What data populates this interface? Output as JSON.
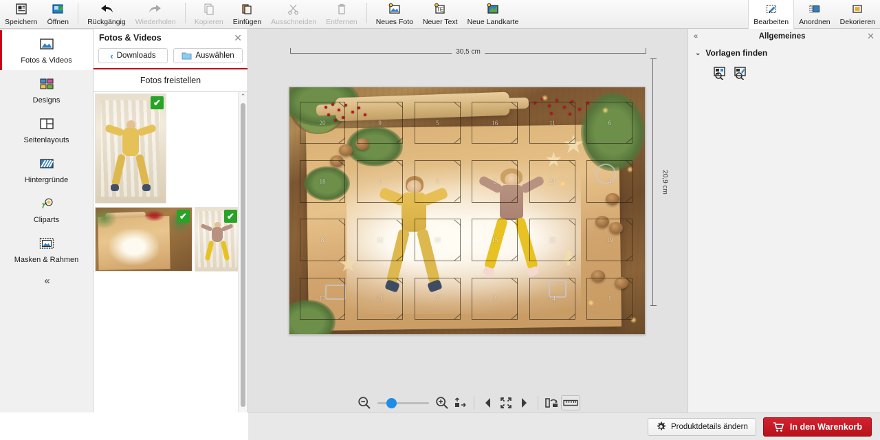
{
  "toolbar": {
    "groups": [
      {
        "items": [
          {
            "label": "Speichern",
            "icon": "save-icon",
            "enabled": true
          },
          {
            "label": "Öffnen",
            "icon": "open-folder-icon",
            "enabled": true
          }
        ]
      },
      {
        "items": [
          {
            "label": "Rückgängig",
            "icon": "undo-arrow-icon",
            "enabled": true
          },
          {
            "label": "Wiederholen",
            "icon": "redo-arrow-icon",
            "enabled": false
          }
        ]
      },
      {
        "items": [
          {
            "label": "Kopieren",
            "icon": "copy-icon",
            "enabled": false
          },
          {
            "label": "Einfügen",
            "icon": "paste-icon",
            "enabled": true
          },
          {
            "label": "Ausschneiden",
            "icon": "scissors-icon",
            "enabled": false
          },
          {
            "label": "Entfernen",
            "icon": "trash-icon",
            "enabled": false
          }
        ]
      },
      {
        "items": [
          {
            "label": "Neues Foto",
            "icon": "new-photo-icon",
            "enabled": true
          },
          {
            "label": "Neuer Text",
            "icon": "new-text-icon",
            "enabled": true
          },
          {
            "label": "Neue Landkarte",
            "icon": "new-map-icon",
            "enabled": true
          }
        ]
      }
    ],
    "right_items": [
      {
        "label": "Bearbeiten",
        "icon": "edit-pencil-icon",
        "active": true
      },
      {
        "label": "Anordnen",
        "icon": "arrange-icon",
        "active": false
      },
      {
        "label": "Dekorieren",
        "icon": "decorate-frame-icon",
        "active": false
      }
    ]
  },
  "sidebar": {
    "items": [
      {
        "label": "Fotos & Videos",
        "icon": "photo-icon",
        "selected": true
      },
      {
        "label": "Designs",
        "icon": "designs-grid-icon",
        "selected": false
      },
      {
        "label": "Seitenlayouts",
        "icon": "page-layout-icon",
        "selected": false
      },
      {
        "label": "Hintergründe",
        "icon": "background-pattern-icon",
        "selected": false
      },
      {
        "label": "Cliparts",
        "icon": "flower-clipart-icon",
        "selected": false
      },
      {
        "label": "Masken & Rahmen",
        "icon": "mask-frame-icon",
        "selected": false
      }
    ],
    "collapse_label": "«"
  },
  "panel": {
    "title": "Fotos & Videos",
    "close_label": "✕",
    "back_button": "Downloads",
    "back_chevron": "‹",
    "choose_button": "Auswählen",
    "tab_label": "Fotos freistellen",
    "thumbnails": [
      {
        "name": "kind-im-mehl-gelb",
        "selected": true,
        "check": "✔"
      },
      {
        "name": "holzbrett-mit-mehl",
        "selected": true,
        "check": "✔"
      },
      {
        "name": "maedchen-im-mehl",
        "selected": true,
        "check": "✔"
      }
    ],
    "footer_icons": [
      {
        "icon": "zoom-out-icon",
        "enabled": true
      },
      {
        "icon": "zoom-in-icon",
        "enabled": true
      },
      {
        "icon": "grid-view-icon",
        "enabled": true
      },
      {
        "icon": "rotate-photo-icon",
        "enabled": false
      },
      {
        "icon": "photo-info-icon",
        "enabled": false
      },
      {
        "icon": "photo-search-icon",
        "enabled": false
      }
    ],
    "scroll_up": "⌃",
    "scroll_down": "⌄"
  },
  "canvas": {
    "ruler_horizontal": "30,5 cm",
    "ruler_vertical": "20,9 cm",
    "advent": {
      "columns": 6,
      "rows": 4,
      "door_numbers": [
        [
          20,
          9,
          5,
          16,
          11,
          6
        ],
        [
          18,
          1,
          3,
          2,
          23,
          4
        ],
        [
          8,
          12,
          10,
          15,
          22,
          19
        ],
        [
          17,
          21,
          7,
          2,
          14,
          1
        ]
      ]
    }
  },
  "canvas_tools": {
    "zoom_out_icon": "zoom-out-icon",
    "zoom_in_icon": "zoom-in-icon",
    "fit_icon": "fit-to-object-icon",
    "prev_icon": "previous-page-icon",
    "fullscreen_icon": "fit-page-icon",
    "next_icon": "next-page-icon",
    "page_swap_icon": "page-swap-icon",
    "ruler_icon": "ruler-icon"
  },
  "right_panel": {
    "collapse_label": "«",
    "title": "Allgemeines",
    "close_label": "✕",
    "sections": [
      {
        "caret": "⌄",
        "title": "Vorlagen finden",
        "buttons": [
          {
            "icon": "find-template-icon"
          },
          {
            "icon": "find-template-edit-icon"
          }
        ]
      }
    ]
  },
  "bottom_bar": {
    "details_button": "Produktdetails ändern",
    "details_icon": "gear-icon",
    "cart_button": "In den Warenkorb",
    "cart_icon": "shopping-cart-icon"
  },
  "colors": {
    "accent_red": "#cc0018",
    "cart_red": "#c4141f",
    "selection_green": "#27a327",
    "link_blue": "#1e87e8"
  }
}
